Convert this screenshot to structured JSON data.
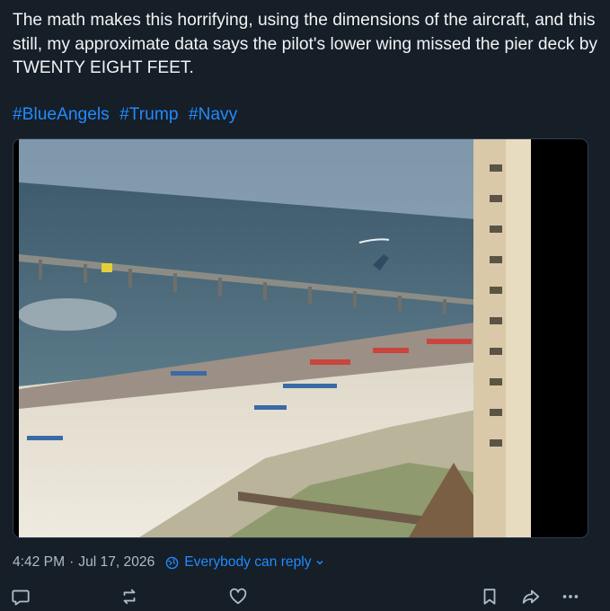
{
  "post": {
    "text": "The math makes this horrifying, using the dimensions of the aircraft, and this still, my approximate data says the pilot's lower wing missed the pier deck by TWENTY EIGHT FEET.",
    "hashtags": [
      "#BlueAngels",
      "#Trump",
      "#Navy"
    ],
    "media": {
      "description_icon": "photo-beach-pier-jet"
    },
    "timestamp_time": "4:42 PM",
    "timestamp_separator": "·",
    "timestamp_date": "Jul 17, 2026",
    "reply_setting": "Everybody can reply"
  },
  "actions": {
    "reply_icon": "speech-bubble-icon",
    "repost_icon": "repost-icon",
    "like_icon": "heart-icon",
    "bookmark_icon": "bookmark-icon",
    "share_icon": "share-arrow-icon",
    "more_icon": "ellipsis-icon"
  },
  "colors": {
    "background": "#161e27",
    "text": "#f1f3f5",
    "muted": "#aebbc9",
    "link": "#208bfe"
  }
}
